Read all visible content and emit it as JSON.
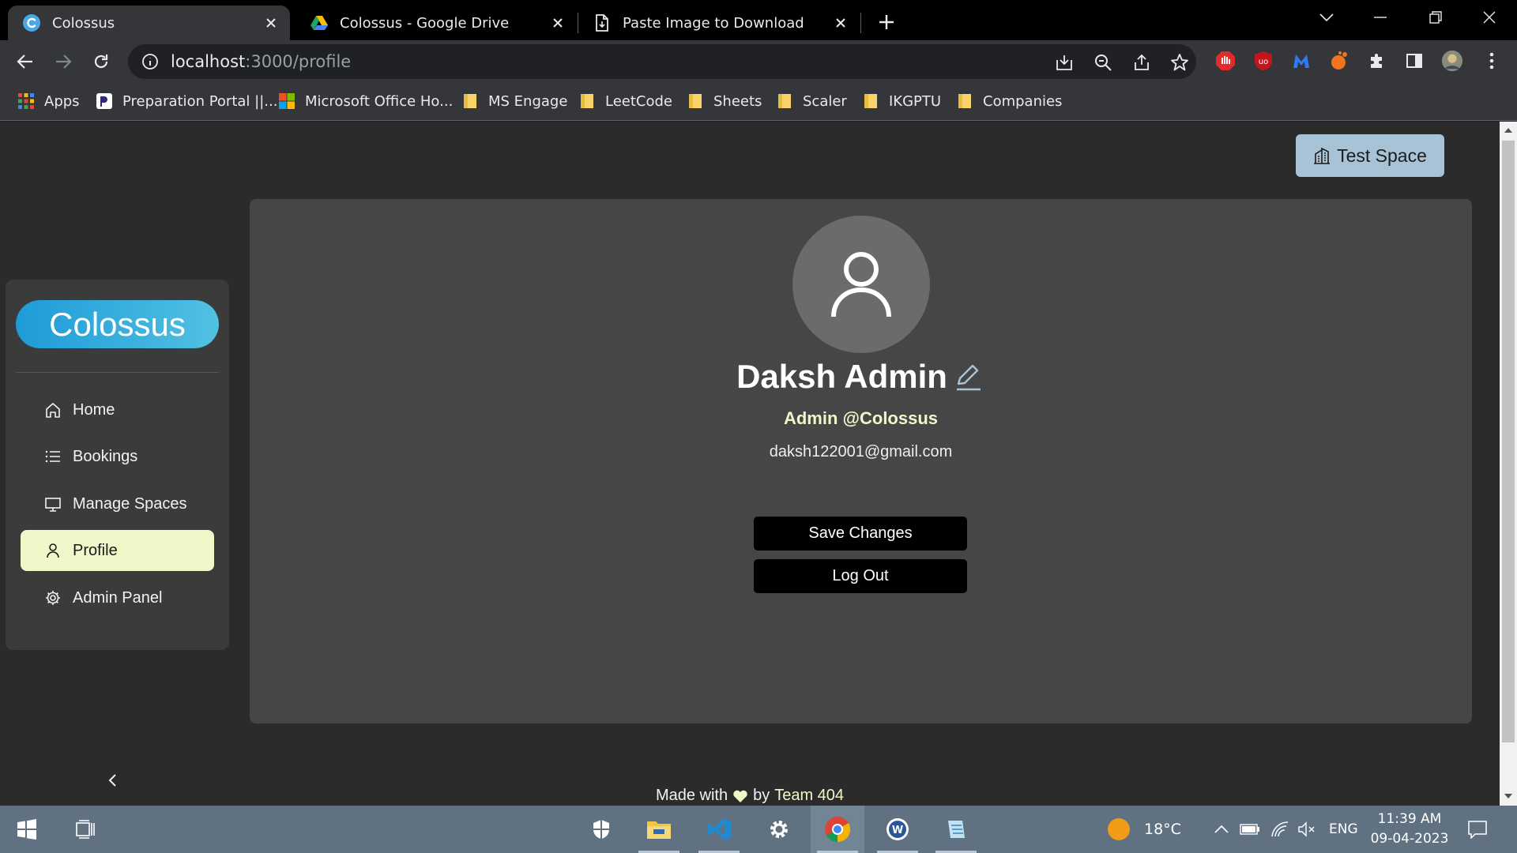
{
  "browser": {
    "tabs": [
      {
        "title": "Colossus",
        "favicon": "colossus-icon"
      },
      {
        "title": "Colossus - Google Drive",
        "favicon": "google-drive-icon"
      },
      {
        "title": "Paste Image to Download",
        "favicon": "document-icon"
      }
    ],
    "url_host": "localhost",
    "url_path": ":3000/profile",
    "bookmarks": [
      {
        "label": "Apps",
        "icon": "apps-grid-icon"
      },
      {
        "label": "Preparation Portal ||...",
        "icon": "portal-icon"
      },
      {
        "label": "Microsoft Office Ho...",
        "icon": "microsoft-icon"
      },
      {
        "label": "MS Engage",
        "icon": "folder-icon"
      },
      {
        "label": "LeetCode",
        "icon": "folder-icon"
      },
      {
        "label": "Sheets",
        "icon": "folder-icon"
      },
      {
        "label": "Scaler",
        "icon": "folder-icon"
      },
      {
        "label": "IKGPTU",
        "icon": "folder-icon"
      },
      {
        "label": "Companies",
        "icon": "folder-icon"
      }
    ]
  },
  "page": {
    "top_button": "Test Space",
    "brand": "Colossus",
    "sidebar": {
      "items": [
        {
          "label": "Home",
          "icon": "home-icon"
        },
        {
          "label": "Bookings",
          "icon": "list-icon"
        },
        {
          "label": "Manage Spaces",
          "icon": "monitor-icon"
        },
        {
          "label": "Profile",
          "icon": "user-icon",
          "active": true
        },
        {
          "label": "Admin Panel",
          "icon": "gear-icon"
        }
      ]
    },
    "profile": {
      "name": "Daksh Admin",
      "role": "Admin @Colossus",
      "email": "daksh122001@gmail.com",
      "save_label": "Save Changes",
      "logout_label": "Log Out"
    },
    "footer": {
      "made_with": "Made with",
      "by": "by",
      "team": "Team 404"
    }
  },
  "taskbar": {
    "weather": "18°C",
    "language": "ENG",
    "time": "11:39 AM",
    "date": "09-04-2023"
  },
  "colors": {
    "accent_gradient_start": "#1e9bd7",
    "accent_gradient_end": "#52c1e3",
    "highlight": "#eef8c8",
    "card": "#464646",
    "page_bg": "#2b2b2b"
  }
}
